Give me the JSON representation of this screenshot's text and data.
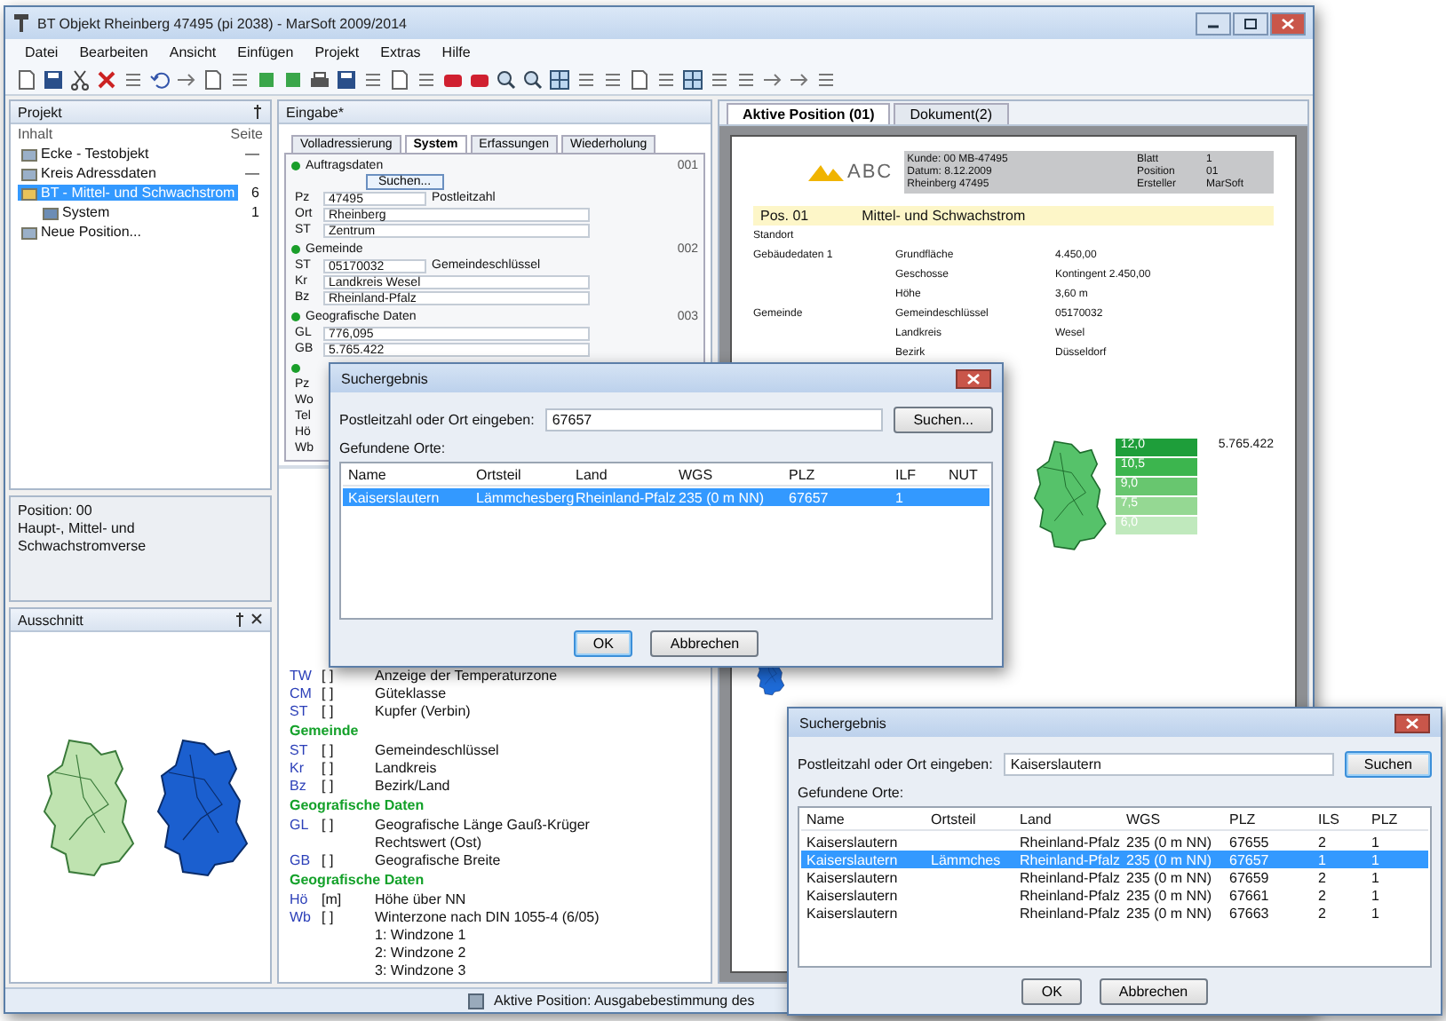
{
  "window": {
    "title": "BT Objekt Rheinberg 47495 (pi 2038) - MarSoft 2009/2014"
  },
  "menu": [
    "Datei",
    "Bearbeiten",
    "Ansicht",
    "Einfügen",
    "Projekt",
    "Extras",
    "Hilfe"
  ],
  "project_panel": {
    "title": "Projekt",
    "columns": [
      "Inhalt",
      "Seite"
    ],
    "tree": [
      {
        "label": "Ecke - Testobjekt",
        "page": "—",
        "selected": false
      },
      {
        "label": "Kreis Adressdaten",
        "page": "—",
        "selected": false
      },
      {
        "label": "BT - Mittel- und Schwachstrom",
        "page": "6",
        "selected": true,
        "children": [
          {
            "label": "System",
            "page": "1",
            "selected": false
          }
        ]
      },
      {
        "label": "Neue Position...",
        "selected": false
      }
    ]
  },
  "info_panel": {
    "lines": [
      "Position: 00",
      "Haupt-, Mittel- und Schwachstromverse"
    ]
  },
  "map_panel": {
    "title": "Ausschnitt"
  },
  "input_panel": {
    "title": "Eingabe*",
    "tabs": [
      {
        "label": "Volladressierung",
        "selected": false
      },
      {
        "label": "System",
        "selected": true
      },
      {
        "label": "Erfassungen",
        "selected": false
      },
      {
        "label": "Wiederholung",
        "selected": false
      }
    ],
    "search_button": "Suchen...",
    "sections": [
      {
        "title": "Auftragsdaten",
        "code": "001",
        "rows": [
          {
            "key": "Pz",
            "value": "47495",
            "note": "Postleitzahl"
          },
          {
            "key": "Ort",
            "value": "Rheinberg"
          },
          {
            "key": "ST",
            "value": "Zentrum"
          }
        ]
      },
      {
        "title": "Gemeinde",
        "code": "002",
        "rows": [
          {
            "key": "ST",
            "value": "05170032",
            "note": "Gemeindeschlüssel"
          },
          {
            "key": "Kr",
            "value": "Landkreis Wesel"
          },
          {
            "key": "Bz",
            "value": "Rheinland-Pfalz"
          }
        ]
      },
      {
        "title": "Geografische Daten",
        "code": "003",
        "rows": [
          {
            "key": "GL",
            "value": "776,095"
          },
          {
            "key": "GB",
            "value": "5.765.422"
          }
        ]
      },
      {
        "rows": [
          {
            "key": "Pz"
          },
          {
            "key": "Wo"
          },
          {
            "key": "Tel"
          },
          {
            "key": "Hö"
          },
          {
            "key": "Wb"
          }
        ]
      }
    ]
  },
  "description": {
    "lines": [
      {
        "kind": "line",
        "code": "TW",
        "unit": "[ ]",
        "text": "Anzeige der Temperaturzone"
      },
      {
        "kind": "line",
        "code": "CM",
        "unit": "[ ]",
        "text": "Güteklasse"
      },
      {
        "kind": "line",
        "code": "ST",
        "unit": "[ ]",
        "text": "Kupfer (Verbin)"
      },
      {
        "kind": "heading",
        "text": "Gemeinde"
      },
      {
        "kind": "line",
        "code": "ST",
        "unit": "[ ]",
        "text": "Gemeindeschlüssel"
      },
      {
        "kind": "line",
        "code": "Kr",
        "unit": "[ ]",
        "text": "Landkreis"
      },
      {
        "kind": "line",
        "code": "Bz",
        "unit": "[ ]",
        "text": "Bezirk/Land"
      },
      {
        "kind": "heading",
        "text": "Geografische Daten"
      },
      {
        "kind": "line",
        "code": "GL",
        "unit": "[ ]",
        "text": "Geografische Länge Gauß-Krüger"
      },
      {
        "kind": "line",
        "text": "Rechtswert (Ost)"
      },
      {
        "kind": "line",
        "code": "GB",
        "unit": "[ ]",
        "text": "Geografische Breite"
      },
      {
        "kind": "heading",
        "text": "Geografische Daten"
      },
      {
        "kind": "line",
        "code": "Hö",
        "unit": "[m]",
        "text": "Höhe über NN"
      },
      {
        "kind": "line",
        "code": "Wb",
        "unit": "[ ]",
        "text": "Winterzone nach DIN 1055-4 (6/05)"
      },
      {
        "kind": "line",
        "text": "1: Windzone 1"
      },
      {
        "kind": "line",
        "text": "2: Windzone 2"
      },
      {
        "kind": "line",
        "text": "3: Windzone 3"
      }
    ]
  },
  "document_panel": {
    "tabs": [
      {
        "label": "Aktive Position (01)",
        "selected": true
      },
      {
        "label": "Dokument(2)",
        "selected": false
      }
    ],
    "logo": "ABC",
    "header_cells": [
      "Kunde: 00 MB-47495",
      "Blatt",
      "1",
      "Datum: 8.12.2009",
      "Position",
      "01",
      "Rheinberg 47495",
      "Ersteller",
      "MarSoft"
    ],
    "heading": {
      "pos": "Pos. 01",
      "text": "Mittel- und Schwachstrom"
    },
    "lines": [
      {
        "label": "Standort"
      },
      {
        "label": "Gebäudedaten 1",
        "a": "Grundfläche",
        "b": "4.450,00"
      },
      {
        "a": "Geschosse",
        "b": "Kontingent 2.450,00"
      },
      {
        "a": "Höhe",
        "b": "3,60 m"
      },
      {
        "label": "Gemeinde",
        "a": "Gemeindeschlüssel",
        "b": "05170032"
      },
      {
        "a": "Landkreis",
        "b": "Wesel"
      },
      {
        "a": "Bezirk",
        "b": "Düsseldorf"
      }
    ],
    "legend": [
      {
        "value": "12,0",
        "color": "#1e9e3a"
      },
      {
        "value": "10,5",
        "color": "#3cb54e"
      },
      {
        "value": "9,0",
        "color": "#68c66f"
      },
      {
        "value": "7,5",
        "color": "#95d893"
      },
      {
        "value": "6,0",
        "color": "#c0e9bd"
      }
    ],
    "total": "5.765.422"
  },
  "dialogs": [
    {
      "title": "Suchergebnis",
      "prompt": "Postleitzahl oder Ort eingeben:",
      "value": "67657",
      "search_button": "Suchen...",
      "list_label": "Gefundene Orte:",
      "columns": [
        "Name",
        "Ortsteil",
        "Land",
        "WGS",
        "PLZ",
        "ILF",
        "NUT"
      ],
      "rows": [
        {
          "cells": [
            "Kaiserslautern",
            "Lämmchesberg",
            "Rheinland-Pfalz",
            "235 (0 m NN)",
            "67657",
            "1"
          ],
          "selected": true
        }
      ],
      "buttons": [
        "OK",
        "Abbrechen"
      ]
    },
    {
      "title": "Suchergebnis",
      "prompt": "Postleitzahl oder Ort eingeben:",
      "value": "Kaiserslautern",
      "search_button": "Suchen",
      "list_label": "Gefundene Orte:",
      "columns": [
        "Name",
        "Ortsteil",
        "Land",
        "WGS",
        "PLZ",
        "ILS",
        "PLZ"
      ],
      "rows": [
        {
          "cells": [
            "Kaiserslautern",
            null,
            "Rheinland-Pfalz",
            "235 (0 m NN)",
            "67655",
            "2",
            "1"
          ],
          "selected": false
        },
        {
          "cells": [
            "Kaiserslautern",
            "Lämmches",
            "Rheinland-Pfalz",
            "235 (0 m NN)",
            "67657",
            "1",
            "1"
          ],
          "selected": true
        },
        {
          "cells": [
            "Kaiserslautern",
            null,
            "Rheinland-Pfalz",
            "235 (0 m NN)",
            "67659",
            "2",
            "1"
          ],
          "selected": false
        },
        {
          "cells": [
            "Kaiserslautern",
            null,
            "Rheinland-Pfalz",
            "235 (0 m NN)",
            "67661",
            "2",
            "1"
          ],
          "selected": false
        },
        {
          "cells": [
            "Kaiserslautern",
            null,
            "Rheinland-Pfalz",
            "235 (0 m NN)",
            "67663",
            "2",
            "1"
          ],
          "selected": false
        }
      ],
      "buttons": [
        "OK",
        "Abbrechen"
      ]
    }
  ],
  "status_bar": "Aktive Position: Ausgabebestimmung des"
}
